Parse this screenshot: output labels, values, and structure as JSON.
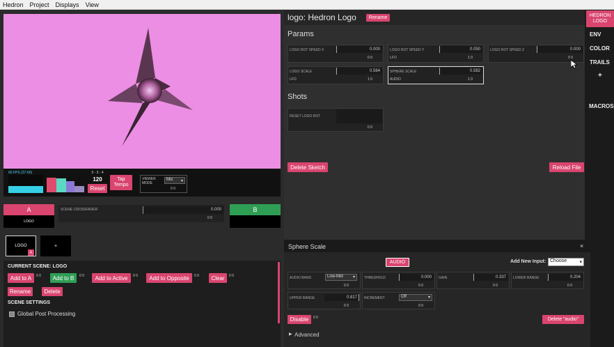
{
  "menu": [
    "Hedron",
    "Project",
    "Displays",
    "View"
  ],
  "viewer": {
    "fps": "60 FPS (27-60)",
    "beat": "3 - 3 - 4",
    "bpm": "120",
    "reset": "Reset",
    "tap": "Tap Tempo",
    "mode_label": "VIEWER MODE",
    "mode_value": "Mix"
  },
  "crossfader": {
    "a": "A",
    "b": "B",
    "a_scene": "LOGO",
    "label": "SCENE CROSSFADER",
    "value": "0.000",
    "mods": "0 0"
  },
  "scenes": {
    "tile1": "LOGO",
    "tile1_badge": "A",
    "add": "+"
  },
  "current_scene": {
    "title": "CURRENT SCENE: LOGO",
    "add_a": "Add to A",
    "add_b": "Add to B",
    "add_active": "Add to Active",
    "add_opposite": "Add to Opposite",
    "clear": "Clear",
    "rename": "Rename",
    "delete": "Delete",
    "mods": "0 0",
    "settings": "SCENE SETTINGS",
    "global_post": "Global Post Processing"
  },
  "sketch": {
    "title": "logo: Hedron Logo",
    "rename": "Rename",
    "params_title": "Params",
    "shots_title": "Shots",
    "delete_sketch": "Delete Sketch",
    "reload": "Reload File",
    "params": [
      {
        "label": "LOGO ROT SPEED X",
        "value": "0.000",
        "input": "",
        "mods": "0 0"
      },
      {
        "label": "LOGO ROT SPEED Y",
        "value": "0.050",
        "input": "LFO",
        "mods": "1 0"
      },
      {
        "label": "LOGO ROT SPEED Z",
        "value": "0.000",
        "input": "",
        "mods": "0 0"
      },
      {
        "label": "LOGO SCALE",
        "value": "0.564",
        "input": "LFO",
        "mods": "1 0"
      },
      {
        "label": "SPHERE SCALE",
        "value": "0.582",
        "input": "AUDIO",
        "mods": "1 0"
      }
    ],
    "shot": {
      "label": "RESET LOGO ROT",
      "mods": "0 0"
    }
  },
  "tabs": [
    "HEDRON LOGO",
    "ENV",
    "COLOR",
    "TRAILS",
    "+",
    "MACROS"
  ],
  "inspector": {
    "title": "Sphere Scale",
    "close": "×",
    "audio_btn": "AUDIO",
    "add_input_label": "Add New Input:",
    "add_input_value": "Choose",
    "fields": [
      {
        "label": "AUDIO BAND",
        "value": "Low-Mid",
        "kind": "select"
      },
      {
        "label": "THRESHOLD",
        "value": "0.000",
        "kind": "num"
      },
      {
        "label": "GAIN",
        "value": "0.337",
        "kind": "num"
      },
      {
        "label": "LOWER RANGE",
        "value": "0.204",
        "kind": "num"
      },
      {
        "label": "UPPER RANGE",
        "value": "0.817",
        "kind": "num"
      },
      {
        "label": "INCREMENT",
        "value": "Off",
        "kind": "select"
      }
    ],
    "mods": "0 0",
    "disable": "Disable",
    "delete_audio": "Delete \"audio\"",
    "advanced": "Advanced"
  }
}
